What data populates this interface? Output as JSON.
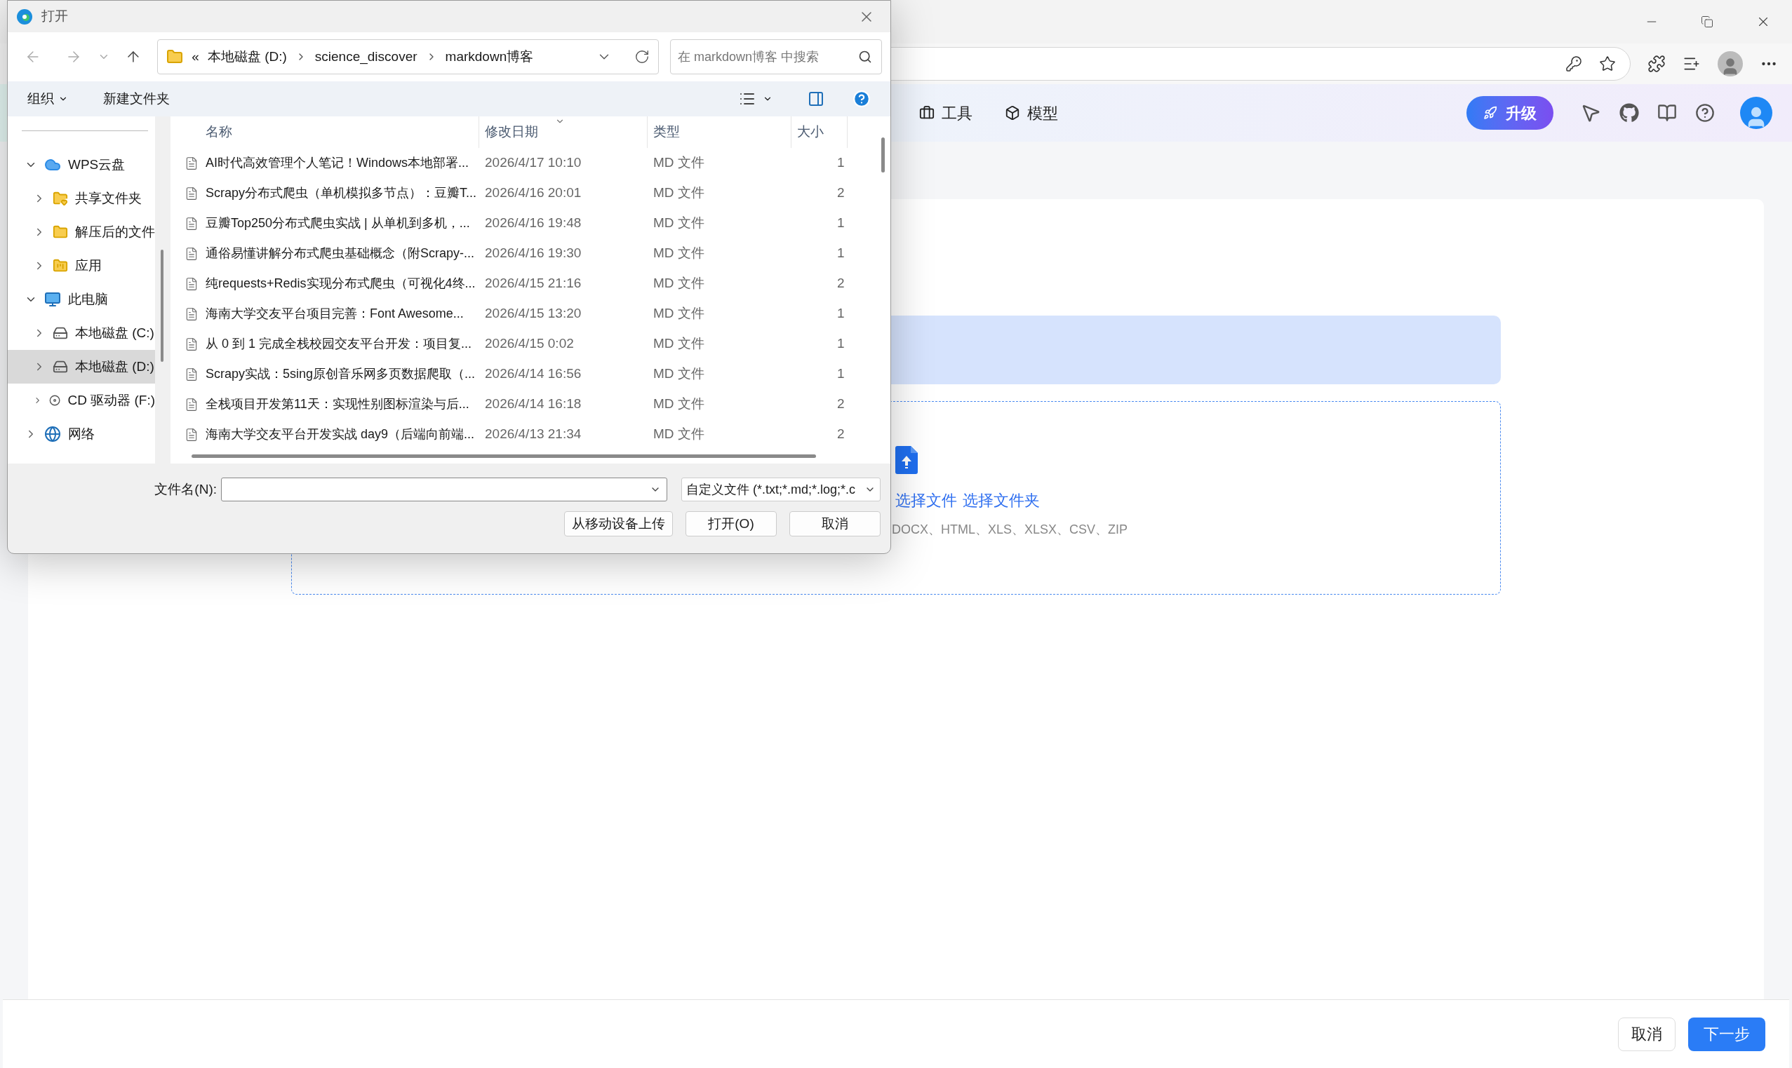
{
  "app_header": {
    "nav": [
      {
        "label": "工具",
        "kind": "tools"
      },
      {
        "label": "模型",
        "kind": "models"
      }
    ],
    "upgrade": "升级"
  },
  "upload": {
    "links": [
      "选择文件",
      "选择文件夹"
    ],
    "formats": "DOCX、HTML、XLS、XLSX、CSV、ZIP"
  },
  "footer": {
    "buttons": [
      {
        "label": "取消",
        "kind": "secondary"
      },
      {
        "label": "下一步",
        "kind": "primary"
      }
    ]
  },
  "dialog": {
    "title": "打开",
    "path": {
      "overflow": "«",
      "crumbs": [
        "本地磁盘 (D:)",
        "science_discover",
        "markdown博客"
      ]
    },
    "search": {
      "placeholder": "在 markdown博客 中搜索"
    },
    "toolbar": [
      {
        "label": "组织",
        "menu": true
      },
      {
        "label": "新建文件夹",
        "menu": false
      }
    ],
    "sidebar": [
      {
        "label": "WPS云盘",
        "kind": "cloud",
        "expanded": true,
        "selected": false,
        "children": [
          {
            "label": "共享文件夹",
            "kind": "shared",
            "expanded": false,
            "selected": false
          },
          {
            "label": "解压后的文件",
            "kind": "folder",
            "expanded": false,
            "selected": false
          },
          {
            "label": "应用",
            "kind": "apps",
            "expanded": false,
            "selected": false
          }
        ]
      },
      {
        "label": "此电脑",
        "kind": "pc",
        "expanded": true,
        "selected": false,
        "children": [
          {
            "label": "本地磁盘 (C:)",
            "kind": "drive",
            "expanded": false,
            "selected": false
          },
          {
            "label": "本地磁盘 (D:)",
            "kind": "drive",
            "expanded": false,
            "selected": true
          },
          {
            "label": "CD 驱动器 (F:)",
            "kind": "cd",
            "expanded": false,
            "selected": false
          }
        ]
      },
      {
        "label": "网络",
        "kind": "network",
        "expanded": false,
        "selected": false
      }
    ],
    "columns": [
      {
        "label": "名称",
        "sorted": false
      },
      {
        "label": "修改日期",
        "sorted": true
      },
      {
        "label": "类型",
        "sorted": false
      },
      {
        "label": "大小",
        "sorted": false
      }
    ],
    "files": [
      {
        "name": "AI时代高效管理个人笔记！Windows本地部署...",
        "modified": "2026/4/17 10:10",
        "type": "MD 文件",
        "size": "1"
      },
      {
        "name": "Scrapy分布式爬虫（单机模拟多节点）：豆瓣T...",
        "modified": "2026/4/16 20:01",
        "type": "MD 文件",
        "size": "2"
      },
      {
        "name": "豆瓣Top250分布式爬虫实战 | 从单机到多机，...",
        "modified": "2026/4/16 19:48",
        "type": "MD 文件",
        "size": "1"
      },
      {
        "name": "通俗易懂讲解分布式爬虫基础概念（附Scrapy-...",
        "modified": "2026/4/16 19:30",
        "type": "MD 文件",
        "size": "1"
      },
      {
        "name": "纯requests+Redis实现分布式爬虫（可视化4终...",
        "modified": "2026/4/15 21:16",
        "type": "MD 文件",
        "size": "2"
      },
      {
        "name": "海南大学交友平台项目完善：Font Awesome...",
        "modified": "2026/4/15 13:20",
        "type": "MD 文件",
        "size": "1"
      },
      {
        "name": "从 0 到 1 完成全栈校园交友平台开发：项目复...",
        "modified": "2026/4/15 0:02",
        "type": "MD 文件",
        "size": "1"
      },
      {
        "name": "Scrapy实战：5sing原创音乐网多页数据爬取（...",
        "modified": "2026/4/14 16:56",
        "type": "MD 文件",
        "size": "1"
      },
      {
        "name": "全栈项目开发第11天：实现性别图标渲染与后...",
        "modified": "2026/4/14 16:18",
        "type": "MD 文件",
        "size": "2"
      },
      {
        "name": "海南大学交友平台开发实战 day9（后端向前端...",
        "modified": "2026/4/13 21:34",
        "type": "MD 文件",
        "size": "2"
      }
    ],
    "filename": {
      "label": "文件名(N):"
    },
    "filetype": "自定义文件 (*.txt;*.md;*.log;*.c",
    "buttons": [
      "从移动设备上传",
      "打开(O)",
      "取消"
    ]
  }
}
